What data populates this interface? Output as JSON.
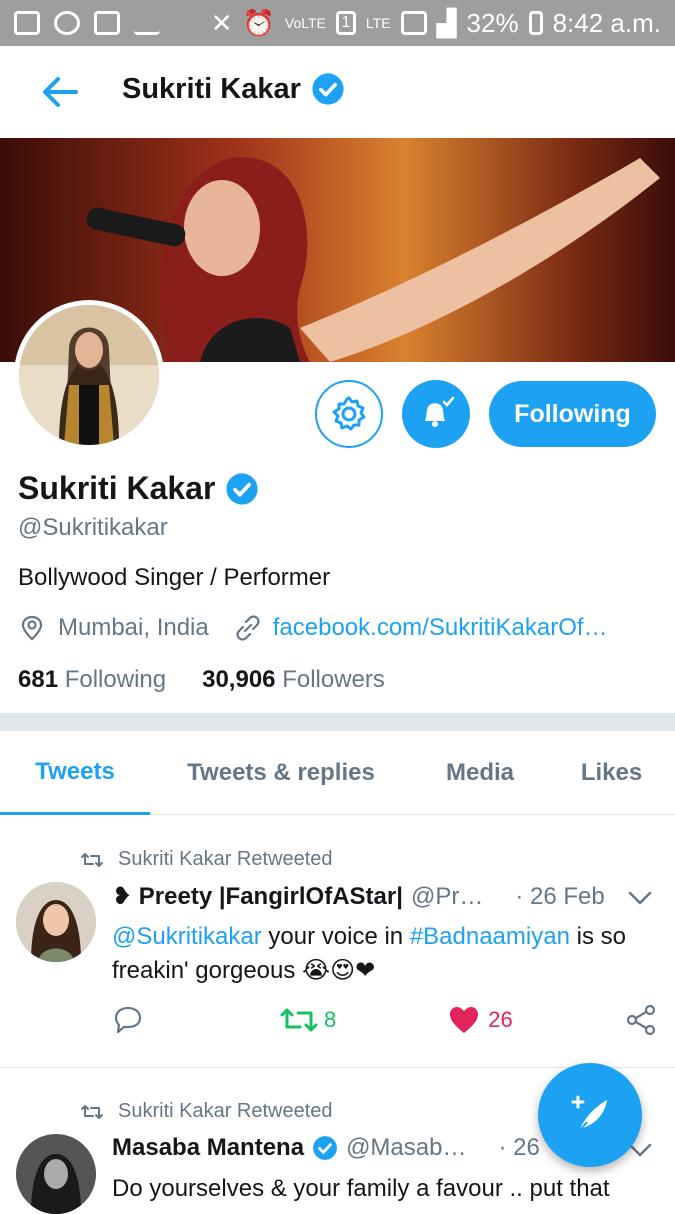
{
  "status_bar": {
    "battery": "32%",
    "time": "8:42 a.m.",
    "network": "LTE",
    "sim": "1"
  },
  "header": {
    "title": "Sukriti Kakar"
  },
  "profile": {
    "name": "Sukriti Kakar",
    "handle": "@Sukritikakar",
    "bio": "Bollywood Singer / Performer",
    "location": "Mumbai, India",
    "website": "facebook.com/SukritiKakarOf…",
    "following_count": "681",
    "following_label": "Following",
    "followers_count": "30,906",
    "followers_label": "Followers",
    "follow_button": "Following"
  },
  "tabs": [
    {
      "label": "Tweets",
      "active": true
    },
    {
      "label": "Tweets & replies",
      "active": false
    },
    {
      "label": "Media",
      "active": false
    },
    {
      "label": "Likes",
      "active": false
    }
  ],
  "tweets": [
    {
      "retweet_label": "Sukriti Kakar Retweeted",
      "name": "❥ Preety |FangirlOfAStar|",
      "handle": "@Pr…",
      "date": "· 26 Feb",
      "text_mention": "@Sukritikakar",
      "text_1": " your voice in ",
      "text_hashtag": "#Badnaamiyan",
      "text_2": " is so freakin' gorgeous 😭😍❤",
      "retweets": "8",
      "likes": "26"
    },
    {
      "retweet_label": "Sukriti Kakar Retweeted",
      "name": "Masaba Mantena",
      "handle": "@Masab…",
      "date": "· 26",
      "text": "Do yourselves & your family a favour .. put that"
    }
  ],
  "colors": {
    "accent": "#1da1f2",
    "retweet_green": "#17bf63",
    "like_red": "#e0245e",
    "muted": "#657786"
  }
}
